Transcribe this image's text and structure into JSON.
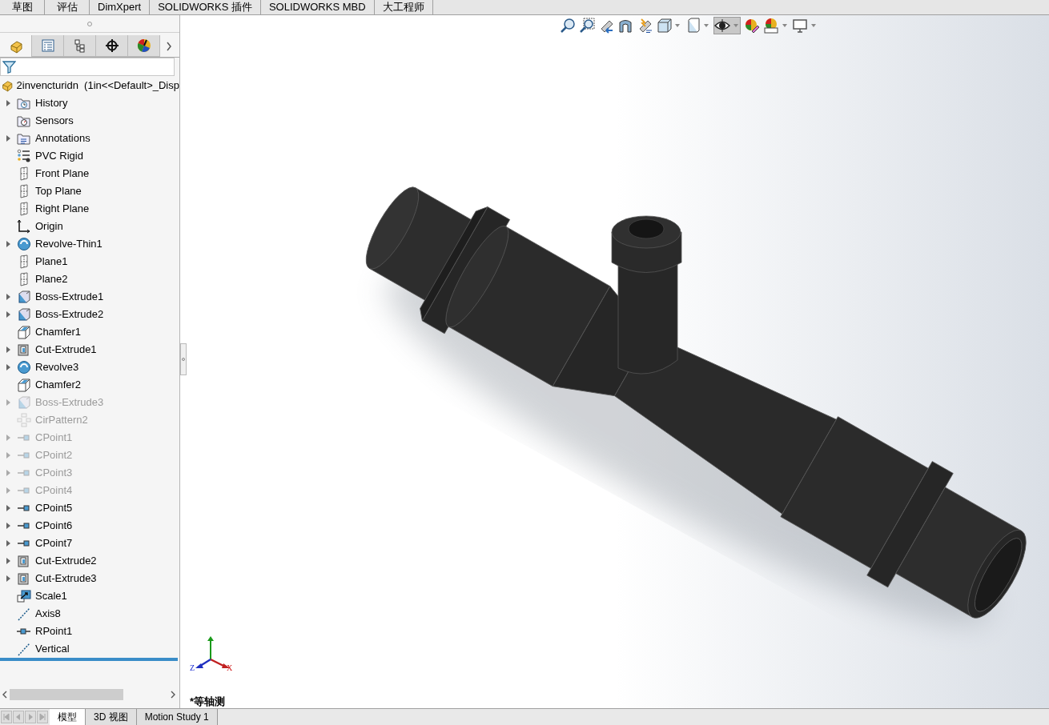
{
  "command_tabs": [
    {
      "label": "草图"
    },
    {
      "label": "评估"
    },
    {
      "label": "DimXpert"
    },
    {
      "label": "SOLIDWORKS 插件"
    },
    {
      "label": "SOLIDWORKS MBD"
    },
    {
      "label": "大工程师"
    }
  ],
  "panel_tabs": [
    {
      "kind": "feature",
      "selected": true
    },
    {
      "kind": "property",
      "selected": false
    },
    {
      "kind": "config",
      "selected": false
    },
    {
      "kind": "dim",
      "selected": false
    },
    {
      "kind": "display",
      "selected": false
    }
  ],
  "tree": {
    "root": "2invencturidn  (1in<<Default>_Disp",
    "items": [
      {
        "label": "History",
        "kind": "history",
        "expandable": true,
        "suppressed": false
      },
      {
        "label": "Sensors",
        "kind": "sensors",
        "expandable": false,
        "suppressed": false
      },
      {
        "label": "Annotations",
        "kind": "annotations",
        "expandable": true,
        "suppressed": false
      },
      {
        "label": "PVC Rigid",
        "kind": "material",
        "expandable": false,
        "suppressed": false
      },
      {
        "label": "Front Plane",
        "kind": "plane",
        "expandable": false,
        "suppressed": false
      },
      {
        "label": "Top Plane",
        "kind": "plane",
        "expandable": false,
        "suppressed": false
      },
      {
        "label": "Right Plane",
        "kind": "plane",
        "expandable": false,
        "suppressed": false
      },
      {
        "label": "Origin",
        "kind": "origin",
        "expandable": false,
        "suppressed": false
      },
      {
        "label": "Revolve-Thin1",
        "kind": "revolve",
        "expandable": true,
        "suppressed": false
      },
      {
        "label": "Plane1",
        "kind": "plane",
        "expandable": false,
        "suppressed": false
      },
      {
        "label": "Plane2",
        "kind": "plane",
        "expandable": false,
        "suppressed": false
      },
      {
        "label": "Boss-Extrude1",
        "kind": "boss",
        "expandable": true,
        "suppressed": false
      },
      {
        "label": "Boss-Extrude2",
        "kind": "boss",
        "expandable": true,
        "suppressed": false
      },
      {
        "label": "Chamfer1",
        "kind": "chamfer",
        "expandable": false,
        "suppressed": false
      },
      {
        "label": "Cut-Extrude1",
        "kind": "cut",
        "expandable": true,
        "suppressed": false
      },
      {
        "label": "Revolve3",
        "kind": "revolve",
        "expandable": true,
        "suppressed": false
      },
      {
        "label": "Chamfer2",
        "kind": "chamfer",
        "expandable": false,
        "suppressed": false
      },
      {
        "label": "Boss-Extrude3",
        "kind": "boss",
        "expandable": true,
        "suppressed": true
      },
      {
        "label": "CirPattern2",
        "kind": "pattern",
        "expandable": false,
        "suppressed": true
      },
      {
        "label": "CPoint1",
        "kind": "cpoint",
        "expandable": true,
        "suppressed": true
      },
      {
        "label": "CPoint2",
        "kind": "cpoint",
        "expandable": true,
        "suppressed": true
      },
      {
        "label": "CPoint3",
        "kind": "cpoint",
        "expandable": true,
        "suppressed": true
      },
      {
        "label": "CPoint4",
        "kind": "cpoint",
        "expandable": true,
        "suppressed": true
      },
      {
        "label": "CPoint5",
        "kind": "cpoint",
        "expandable": true,
        "suppressed": false
      },
      {
        "label": "CPoint6",
        "kind": "cpoint",
        "expandable": true,
        "suppressed": false
      },
      {
        "label": "CPoint7",
        "kind": "cpoint",
        "expandable": true,
        "suppressed": false
      },
      {
        "label": "Cut-Extrude2",
        "kind": "cut",
        "expandable": true,
        "suppressed": false
      },
      {
        "label": "Cut-Extrude3",
        "kind": "cut",
        "expandable": true,
        "suppressed": false
      },
      {
        "label": "Scale1",
        "kind": "scale",
        "expandable": false,
        "suppressed": false
      },
      {
        "label": "Axis8",
        "kind": "axis",
        "expandable": false,
        "suppressed": false
      },
      {
        "label": "RPoint1",
        "kind": "rpoint",
        "expandable": false,
        "suppressed": false
      },
      {
        "label": "Vertical",
        "kind": "axis",
        "expandable": false,
        "suppressed": false
      }
    ]
  },
  "viewport": {
    "triad": {
      "x_label": "X",
      "z_label": "Z"
    },
    "view_name": "*等轴测"
  },
  "bottom_tabs": [
    {
      "label": "模型",
      "selected": true
    },
    {
      "label": "3D 视图",
      "selected": false
    },
    {
      "label": "Motion Study 1",
      "selected": false
    }
  ]
}
